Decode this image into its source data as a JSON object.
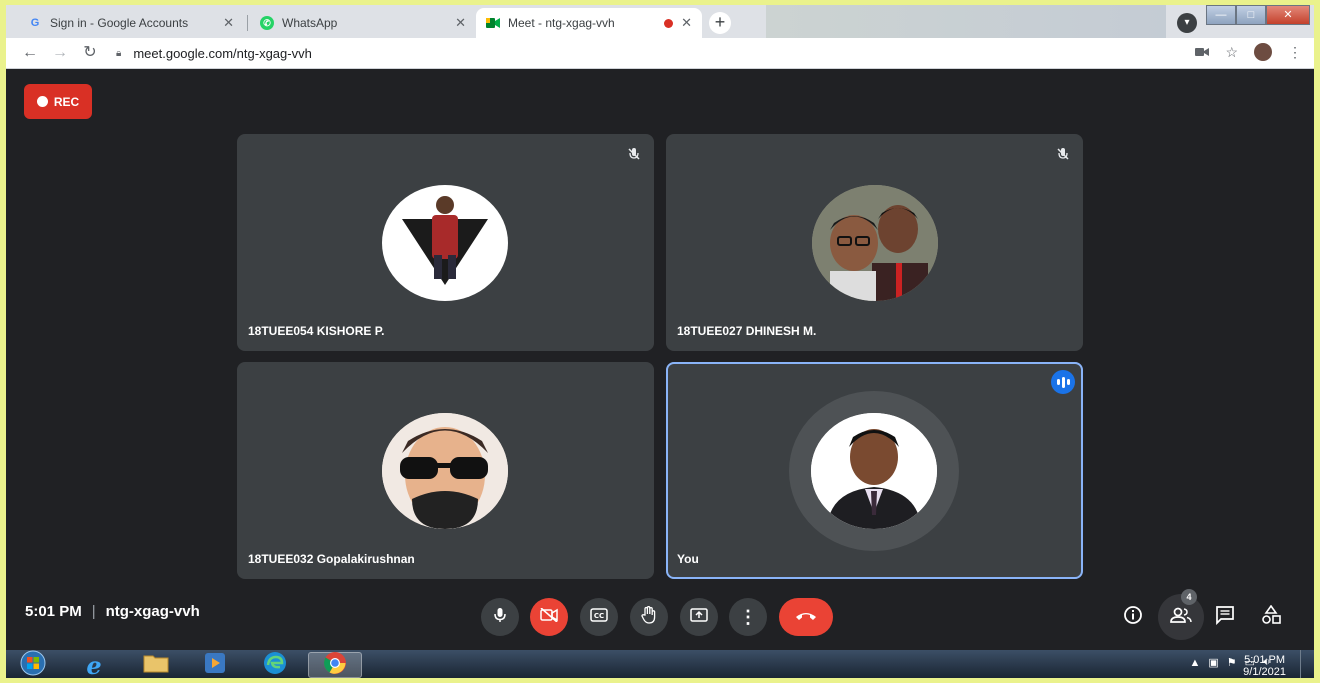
{
  "browser": {
    "tabs": [
      {
        "title": "Sign in - Google Accounts",
        "icon": "google-g-icon"
      },
      {
        "title": "WhatsApp",
        "icon": "whatsapp-icon"
      },
      {
        "title": "Meet - ntg-xgag-vvh",
        "icon": "meet-icon",
        "recording": true
      }
    ],
    "url": "meet.google.com/ntg-xgag-vvh"
  },
  "meet": {
    "rec_label": "REC",
    "participants": [
      {
        "name": "18TUEE054 KISHORE P.",
        "muted": true
      },
      {
        "name": "18TUEE027 DHINESH M.",
        "muted": true
      },
      {
        "name": "18TUEE032 Gopalakirushnan",
        "muted": false
      },
      {
        "name": "You",
        "speaking": true
      }
    ],
    "time": "5:01 PM",
    "meeting_code": "ntg-xgag-vvh",
    "separator": "|",
    "people_count": "4",
    "colors": {
      "end_call": "#ea4335",
      "speaking_outline": "#8ab4f8",
      "rec": "#d93025"
    }
  },
  "taskbar": {
    "clock_time": "5:01 PM",
    "clock_date": "9/1/2021"
  }
}
